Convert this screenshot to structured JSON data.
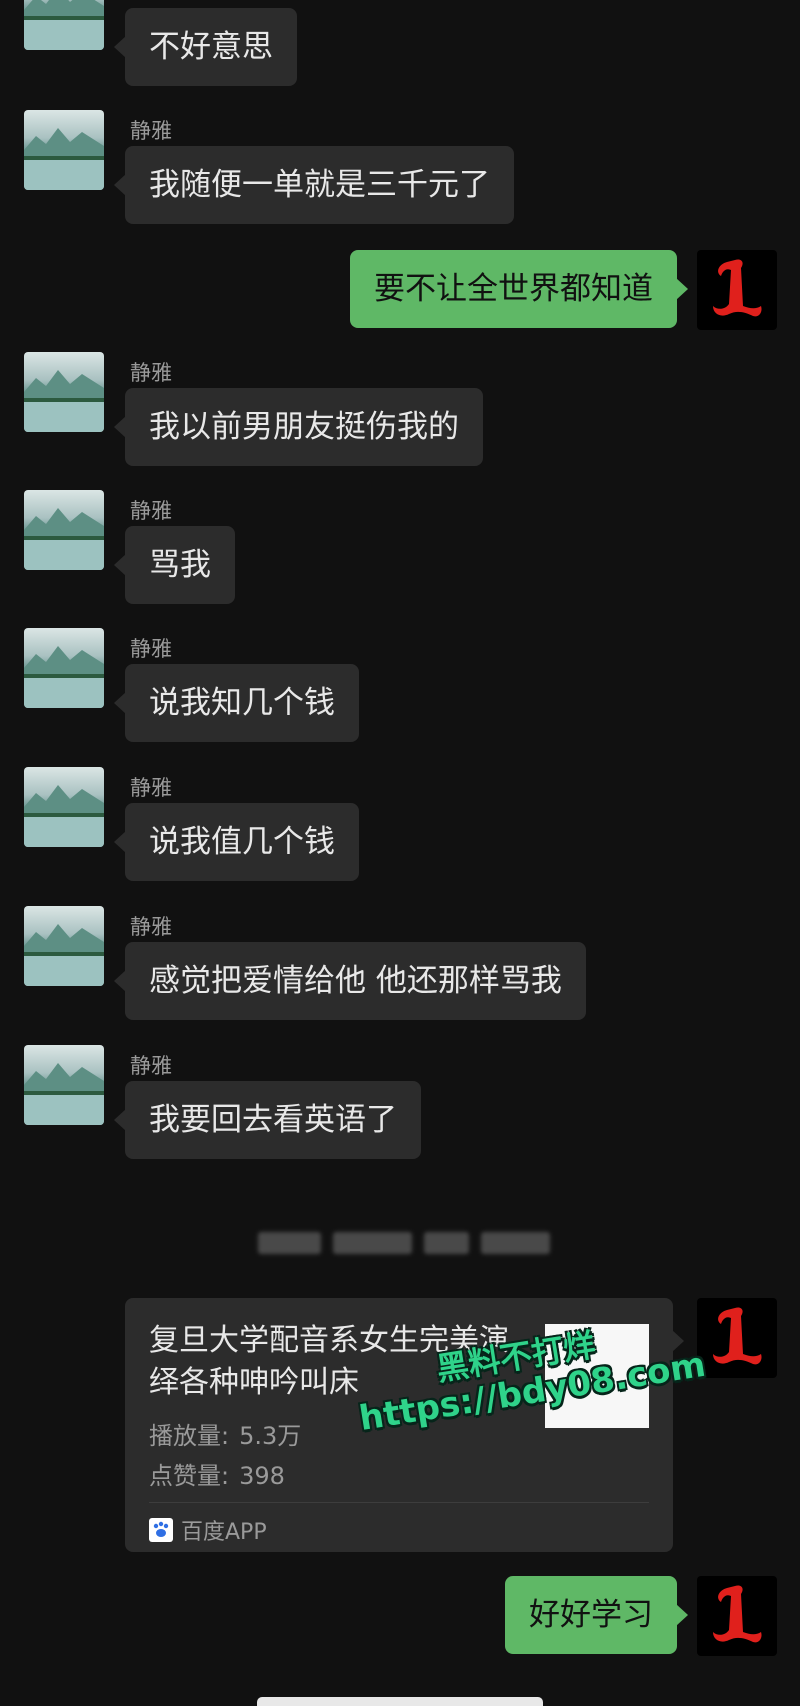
{
  "contact": {
    "name": "静雅"
  },
  "messages": [
    {
      "sender": "contact",
      "text": "不好意思"
    },
    {
      "sender": "contact",
      "name": "静雅",
      "text": "我随便一单就是三千元了"
    },
    {
      "sender": "me",
      "text": "要不让全世界都知道"
    },
    {
      "sender": "contact",
      "name": "静雅",
      "text": "我以前男朋友挺伤我的"
    },
    {
      "sender": "contact",
      "name": "静雅",
      "text": "骂我"
    },
    {
      "sender": "contact",
      "name": "静雅",
      "text": "说我知几个钱"
    },
    {
      "sender": "contact",
      "name": "静雅",
      "text": "说我值几个钱"
    },
    {
      "sender": "contact",
      "name": "静雅",
      "text": "感觉把爱情给他 他还那样骂我"
    },
    {
      "sender": "contact",
      "name": "静雅",
      "text": "我要回去看英语了"
    },
    {
      "sender": "me",
      "text": "好好学习"
    }
  ],
  "shared_card": {
    "title": "复旦大学配音系女生完美演绎各种呻吟叫床",
    "plays_label": "播放量:",
    "plays_value": "5.3万",
    "likes_label": "点赞量:",
    "likes_value": "398",
    "source": "百度APP"
  },
  "watermark": {
    "line1": "黑料不打烊",
    "line2": "https://bdy08.com"
  },
  "colors": {
    "background": "#111111",
    "incoming_bubble": "#2c2c2c",
    "outgoing_bubble": "#5fb866",
    "watermark": "#2fd38a",
    "avatar_letter": "#e0201c"
  },
  "icons": {
    "contact_avatar": "landscape-avatar-icon",
    "me_avatar": "gothic-letter-l-avatar-icon",
    "source_app": "baidu-paw-icon"
  }
}
